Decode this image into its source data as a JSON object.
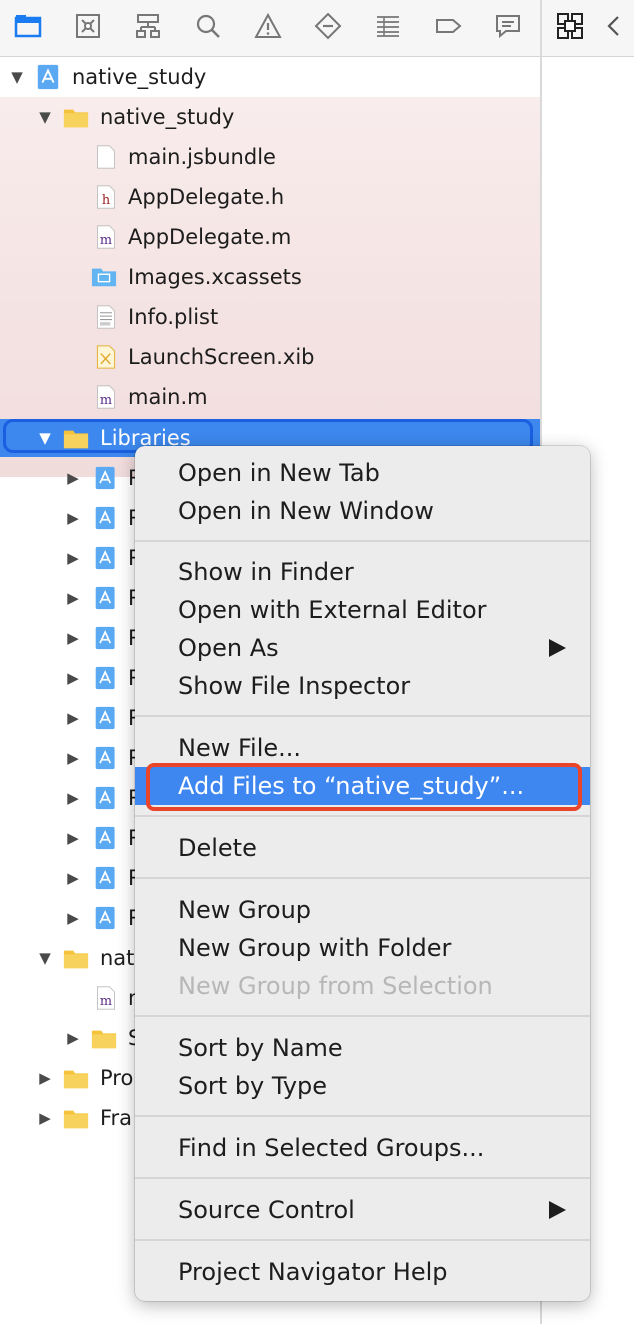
{
  "toolbar": {
    "icons": [
      "folder-icon",
      "source-control-icon",
      "hierarchy-icon",
      "search-icon",
      "warning-icon",
      "test-icon",
      "debug-icon",
      "breakpoint-icon",
      "report-icon"
    ]
  },
  "tree": {
    "root": "native_study",
    "group": "native_study",
    "files": [
      "main.jsbundle",
      "AppDelegate.h",
      "AppDelegate.m",
      "Images.xcassets",
      "Info.plist",
      "LaunchScreen.xib",
      "main.m"
    ],
    "libraries": "Libraries",
    "lib_items": [
      "R",
      "R",
      "R",
      "R",
      "R",
      "R",
      "R",
      "R",
      "R",
      "R",
      "R",
      "R"
    ],
    "tests_group": "nati",
    "tests_file": "n",
    "supporting": "S",
    "products": "Pro",
    "frameworks": "Fra"
  },
  "menu": {
    "items": {
      "open_tab": "Open in New Tab",
      "open_window": "Open in New Window",
      "show_finder": "Show in Finder",
      "open_external": "Open with External Editor",
      "open_as": "Open As",
      "show_inspector": "Show File Inspector",
      "new_file": "New File...",
      "add_files": "Add Files to “native_study”...",
      "delete": "Delete",
      "new_group": "New Group",
      "new_group_folder": "New Group with Folder",
      "new_group_selection": "New Group from Selection",
      "sort_name": "Sort by Name",
      "sort_type": "Sort by Type",
      "find_groups": "Find in Selected Groups...",
      "source_control": "Source Control",
      "navigator_help": "Project Navigator Help"
    }
  },
  "colors": {
    "highlight": "#3e86f0",
    "annotation": "#e8452b",
    "folder": "#f5c33b"
  }
}
